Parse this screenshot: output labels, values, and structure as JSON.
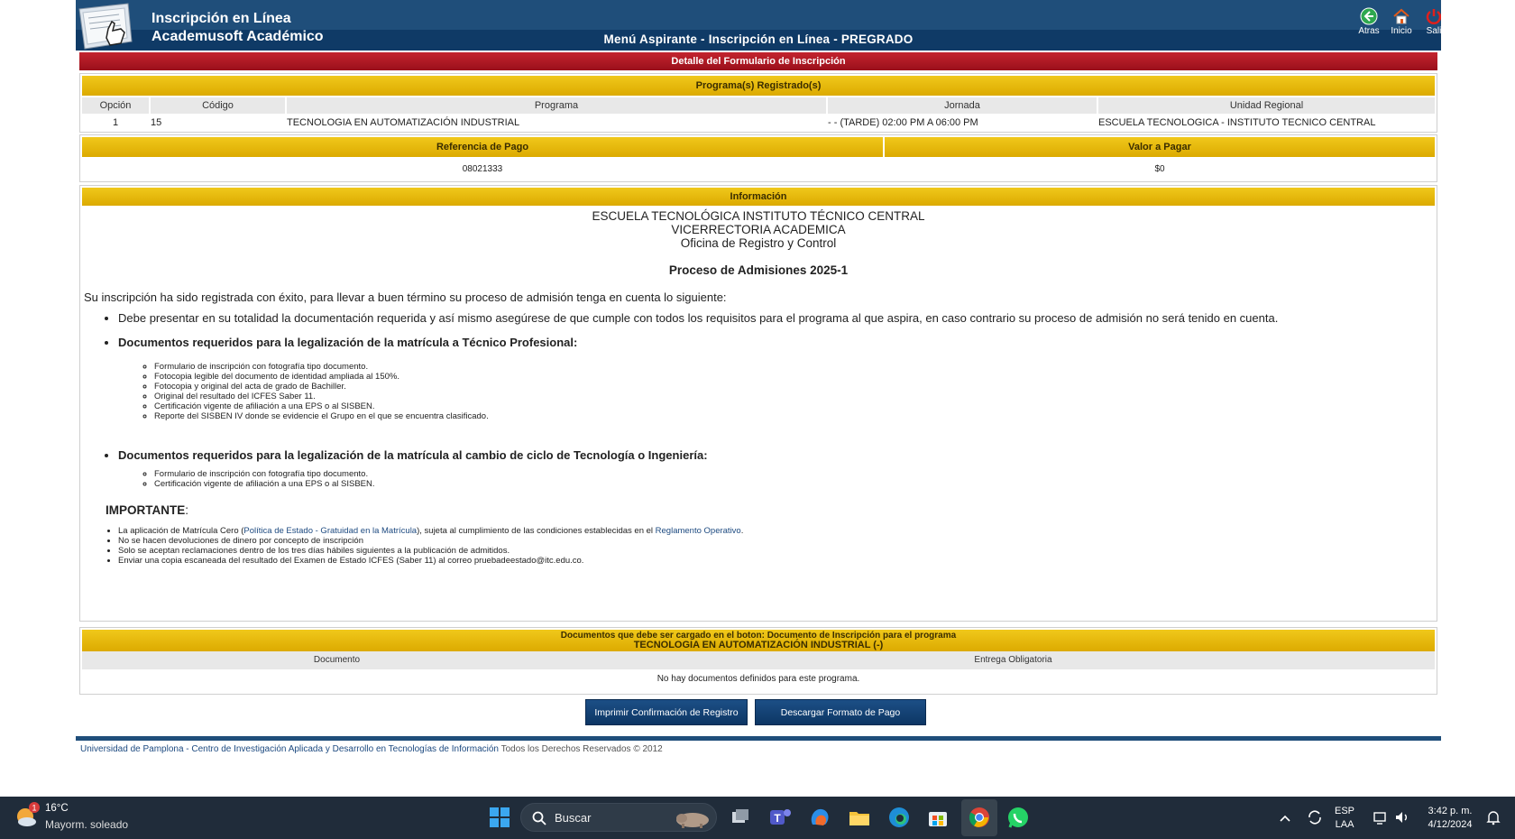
{
  "header": {
    "title_line1": "Inscripción en Línea",
    "title_line2": "Academusoft Académico",
    "menu_title": "Menú Aspirante - Inscripción en Línea - PREGRADO",
    "icons": [
      {
        "name": "back-icon",
        "label": "Atras"
      },
      {
        "name": "home-icon",
        "label": "Inicio"
      },
      {
        "name": "power-icon",
        "label": "Sali"
      }
    ]
  },
  "form_title": "Detalle del Formulario de Inscripción",
  "programs": {
    "heading": "Programa(s) Registrado(s)",
    "columns": [
      "Opción",
      "Código",
      "Programa",
      "Jornada",
      "Unidad Regional"
    ],
    "rows": [
      [
        "1",
        "15",
        "TECNOLOGIA EN AUTOMATIZACIÓN INDUSTRIAL",
        "- - (TARDE) 02:00 PM A 06:00 PM",
        "ESCUELA TECNOLOGICA - INSTITUTO TECNICO CENTRAL"
      ]
    ]
  },
  "payment": {
    "ref_label": "Referencia de Pago",
    "value_label": "Valor a Pagar",
    "ref_value": "08021333",
    "value": "$0"
  },
  "info": {
    "heading": "Información",
    "institution": "ESCUELA TECNOLÓGICA INSTITUTO TÉCNICO CENTRAL",
    "vicerrectoria": "VICERRECTORIA ACADEMICA",
    "office": "Oficina de Registro y Control",
    "process": "Proceso de Admisiones 2025-1",
    "intro": "Su inscripción ha sido registrada con éxito, para llevar a buen término su proceso de admisión tenga en cuenta lo siguiente:",
    "bullet1": "Debe presentar en su totalidad la documentación requerida y así mismo asegúrese de que cumple con todos los requisitos para el programa al que aspira, en caso contrario su proceso de admisión no será tenido en cuenta.",
    "bullet2": "Documentos requeridos para la legalización de la matrícula a Técnico Profesional:",
    "list2": [
      "Formulario de inscripción con fotografía tipo documento.",
      "Fotocopia legible del documento de identidad ampliada al 150%.",
      "Fotocopia y original del acta de grado de Bachiller.",
      "Original del resultado del ICFES Saber 11.",
      "Certificación vigente de afiliación a una EPS o al SISBEN.",
      "Reporte del SISBEN IV donde se evidencie el Grupo en el que se encuentra clasificado."
    ],
    "bullet3": "Documentos requeridos para la legalización de la matrícula al cambio de ciclo de Tecnología o Ingeniería:",
    "list3": [
      "Formulario de inscripción con fotografía tipo documento.",
      "Certificación vigente de afiliación a una EPS o al SISBEN."
    ],
    "important_label": "IMPORTANTE",
    "important_colon": ":",
    "imp1_a": "La aplicación de Matrícula Cero (",
    "imp1_link1": "Política de Estado - Gratuidad en la Matrícula",
    "imp1_b": "), sujeta al cumplimiento de las condiciones establecidas en el ",
    "imp1_link2": "Reglamento Operativo",
    "imp1_c": ".",
    "imp2": "No se hacen devoluciones de dinero por concepto de inscripción",
    "imp3": "Solo se aceptan reclamaciones dentro de los tres días hábiles siguientes a la publicación de admitidos.",
    "imp4": "Enviar una copia escaneada del resultado del Examen de Estado ICFES (Saber 11) al correo pruebadeestado@itc.edu.co."
  },
  "documents": {
    "heading_line1": "Documentos que debe ser cargado en el boton: Documento de Inscripción para el programa",
    "heading_line2": "TECNOLOGIA EN AUTOMATIZACIÓN INDUSTRIAL (-)",
    "col_doc": "Documento",
    "col_required": "Entrega Obligatoria",
    "empty": "No hay documentos definidos para este programa."
  },
  "buttons": {
    "print": "Imprimir Confirmación de Registro",
    "download": "Descargar Formato de Pago"
  },
  "footer": {
    "link": "Universidad de Pamplona - Centro de Investigación Aplicada y Desarrollo en Tecnologías de Información",
    "rights": " Todos los Derechos Reservados © 2012"
  },
  "taskbar": {
    "weather_badge": "1",
    "temperature": "16°C",
    "condition": "Mayorm. soleado",
    "search_label": "Buscar",
    "lang_top": "ESP",
    "lang_bottom": "LAA",
    "time": "3:42 p. m.",
    "date": "4/12/2024"
  }
}
